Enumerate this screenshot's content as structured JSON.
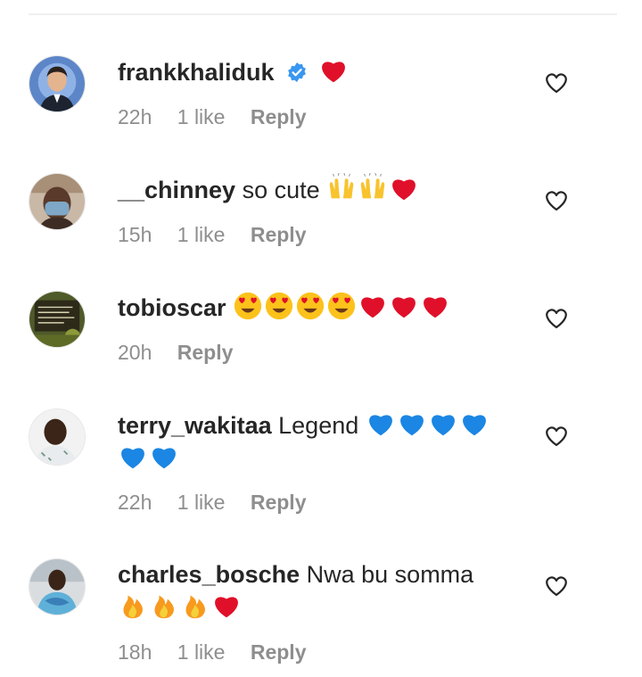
{
  "comments": [
    {
      "username": "frankkhaliduk",
      "verified": true,
      "text": "",
      "emojis": [
        "red-heart"
      ],
      "time": "22h",
      "likes": "1 like",
      "reply": "Reply"
    },
    {
      "username": "__chinney",
      "verified": false,
      "text": "so cute",
      "emojis": [
        "raising-hands",
        "raising-hands",
        "red-heart"
      ],
      "time": "15h",
      "likes": "1 like",
      "reply": "Reply"
    },
    {
      "username": "tobioscar",
      "verified": false,
      "text": "",
      "emojis": [
        "heart-eyes",
        "heart-eyes",
        "heart-eyes",
        "heart-eyes",
        "red-heart",
        "red-heart",
        "red-heart"
      ],
      "time": "20h",
      "likes": "",
      "reply": "Reply"
    },
    {
      "username": "terry_wakitaa",
      "verified": false,
      "text": "Legend",
      "emojis": [
        "blue-heart",
        "blue-heart",
        "blue-heart",
        "blue-heart",
        "blue-heart",
        "blue-heart"
      ],
      "time": "22h",
      "likes": "1 like",
      "reply": "Reply"
    },
    {
      "username": "charles_bosche",
      "verified": false,
      "text": "Nwa bu somma",
      "emojis": [
        "fire",
        "fire",
        "fire",
        "red-heart"
      ],
      "time": "18h",
      "likes": "1 like",
      "reply": "Reply"
    }
  ],
  "colors": {
    "username": "#262626",
    "meta": "#8e8e8e",
    "verified": "#3897f0",
    "red_heart": "#e0102a",
    "blue_heart": "#1b86e3",
    "fire": "#f79a1e"
  }
}
